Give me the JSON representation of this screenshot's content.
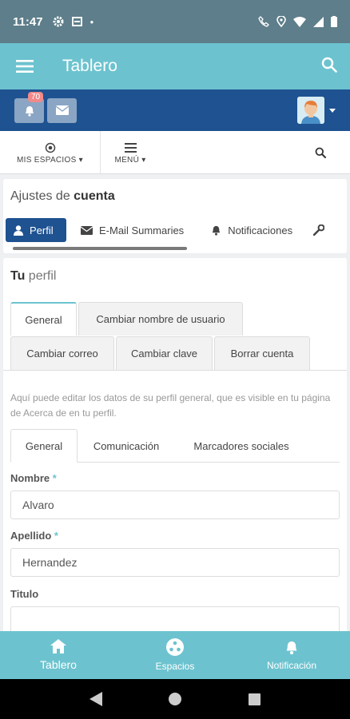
{
  "status": {
    "time": "11:47"
  },
  "appbar": {
    "title": "Tablero"
  },
  "topbar": {
    "notifications_count": "70"
  },
  "nav": {
    "my_spaces": "MIS ESPACIOS",
    "menu": "MENÚ"
  },
  "account": {
    "heading_prefix": "Ajustes de ",
    "heading_bold": "cuenta",
    "tabs": [
      {
        "label": "Perfil",
        "icon": "user-icon"
      },
      {
        "label": "E-Mail Summaries",
        "icon": "envelope-icon"
      },
      {
        "label": "Notificaciones",
        "icon": "bell-icon"
      }
    ]
  },
  "profile": {
    "heading_bold": "Tu",
    "heading_rest": " perfil",
    "tabs": [
      "General",
      "Cambiar nombre de usuario",
      "Cambiar correo",
      "Cambiar clave",
      "Borrar cuenta"
    ],
    "description": "Aquí puede editar los datos de su perfil general, que es visible en tu página de Acerca de en tu perfil.",
    "subtabs": [
      "General",
      "Comunicación",
      "Marcadores sociales"
    ],
    "fields": {
      "nombre_label": "Nombre",
      "nombre_value": "Alvaro",
      "apellido_label": "Apellido",
      "apellido_value": "Hernandez",
      "titulo_label": "Titulo",
      "titulo_value": ""
    }
  },
  "bottomnav": {
    "items": [
      "Tablero",
      "Espacios",
      "Notificación"
    ]
  },
  "colors": {
    "appbar": "#6cc3cf",
    "brand_dark": "#1e5291",
    "status_bar": "#5d7e8a"
  }
}
